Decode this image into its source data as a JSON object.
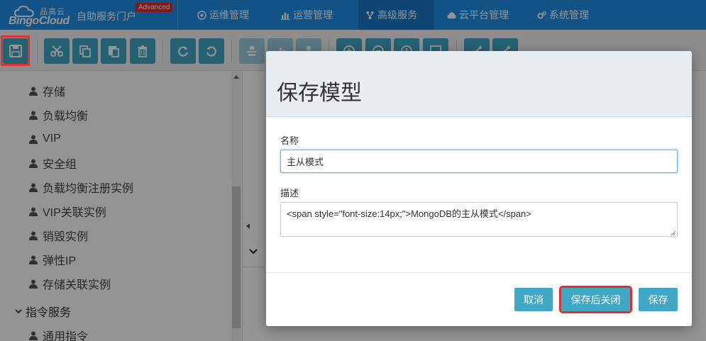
{
  "header": {
    "logo_cn": "品高云",
    "logo_en": "BingoCloud",
    "portal_title": "自助服务门户",
    "badge": "Advanced",
    "nav": [
      {
        "label": "运维管理",
        "icon": "gear-circle-icon"
      },
      {
        "label": "运营管理",
        "icon": "bar-chart-icon"
      },
      {
        "label": "高级服务",
        "icon": "fork-icon",
        "active": true
      },
      {
        "label": "云平台管理",
        "icon": "cloud-icon"
      },
      {
        "label": "系统管理",
        "icon": "cogs-icon"
      }
    ]
  },
  "toolbar": {
    "buttons": [
      "save-icon",
      "cut-icon",
      "copy-icon",
      "paste-icon",
      "delete-icon",
      "redo-icon",
      "undo-icon",
      "align-icon",
      "chart-icon",
      "move-icon",
      "zoom-in-icon",
      "zoom-out-icon",
      "zoom-reset-icon",
      "image-icon",
      "share-icon",
      "share-alt-icon"
    ]
  },
  "sidebar": {
    "items": [
      "存储",
      "负载均衡",
      "VIP",
      "安全组",
      "负载均衡注册实例",
      "VIP关联实例",
      "销毁实例",
      "弹性IP",
      "存储关联实例"
    ],
    "group": "指令服务",
    "group_items": [
      "通用指令"
    ]
  },
  "modal": {
    "title": "保存模型",
    "name_label": "名称",
    "name_value": "主从模式",
    "desc_label": "描述",
    "desc_value": "<span style=\"font-size:14px;\">MongoDB的主从模式</span>",
    "cancel_label": "取消",
    "save_close_label": "保存后关闭",
    "save_label": "保存"
  },
  "colors": {
    "nav_bg": "#1e90e8",
    "accent": "#3ea8c6",
    "highlight": "#e03131"
  }
}
